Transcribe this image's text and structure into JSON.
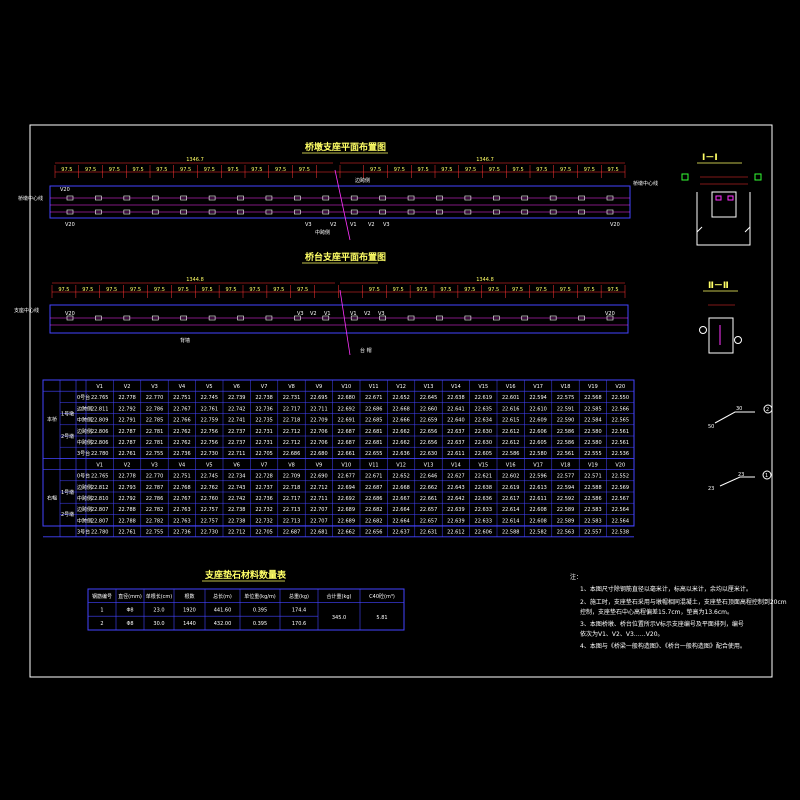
{
  "drawing": {
    "plan1_title": "桥墩支座平面布置图",
    "plan2_title": "桥台支座平面布置图",
    "material_title": "支座垫石材料数量表",
    "section1_title": "Ⅰ－Ⅰ",
    "section2_title": "Ⅱ－Ⅱ"
  },
  "plan1": {
    "dim_left": "1346.7",
    "dim_right": "1346.7",
    "spacing": "97.5",
    "label_left_end": "V20",
    "label_right_end": "V20",
    "label_left_mid": "V20",
    "label_center": "V1",
    "axis_left": "桥墩中心线",
    "axis_right": "桥墩中心线",
    "sub_labels": [
      "V3",
      "V2",
      "V1",
      "V1",
      "V2",
      "V3"
    ],
    "text_a": "边跨侧",
    "text_b": "中跨侧"
  },
  "plan2": {
    "dim_left": "1344.8",
    "dim_right": "1344.8",
    "spacing": "97.5",
    "label_left": "V20",
    "label_right": "V20",
    "axis_left": "支座中心线",
    "sub_labels": [
      "V3",
      "V2",
      "V1",
      "V1",
      "V2",
      "V3"
    ],
    "text_a": "背墙",
    "text_b": "台 帽"
  },
  "elev_table": {
    "cols": [
      "V1",
      "V2",
      "V3",
      "V4",
      "V5",
      "V6",
      "V7",
      "V8",
      "V9",
      "V10",
      "V11",
      "V12",
      "V13",
      "V14",
      "V15",
      "V16",
      "V17",
      "V18",
      "V19",
      "V20"
    ],
    "groups": [
      {
        "name": "本桥",
        "rows": [
          {
            "sub": "",
            "lab": "0号台",
            "vals": [
              "22.765",
              "22.778",
              "22.770",
              "22.751",
              "22.745",
              "22.739",
              "22.738",
              "22.731",
              "22.695",
              "22.680",
              "22.671",
              "22.652",
              "22.645",
              "22.638",
              "22.619",
              "22.601",
              "22.594",
              "22.575",
              "22.568",
              "22.550"
            ]
          },
          {
            "sub": "1号墩",
            "lab": "边跨侧",
            "vals": [
              "22.811",
              "22.792",
              "22.786",
              "22.767",
              "22.761",
              "22.742",
              "22.736",
              "22.717",
              "22.711",
              "22.692",
              "22.686",
              "22.668",
              "22.660",
              "22.641",
              "22.635",
              "22.616",
              "22.610",
              "22.591",
              "22.585",
              "22.566"
            ]
          },
          {
            "sub": "",
            "lab": "中跨侧",
            "vals": [
              "22.809",
              "22.791",
              "22.785",
              "22.766",
              "22.759",
              "22.741",
              "22.735",
              "22.718",
              "22.709",
              "22.691",
              "22.685",
              "22.666",
              "22.659",
              "22.640",
              "22.634",
              "22.615",
              "22.609",
              "22.590",
              "22.584",
              "22.565"
            ]
          },
          {
            "sub": "2号墩",
            "lab": "边跨侧",
            "vals": [
              "22.806",
              "22.787",
              "22.781",
              "22.762",
              "22.756",
              "22.737",
              "22.731",
              "22.712",
              "22.706",
              "22.687",
              "22.681",
              "22.662",
              "22.656",
              "22.637",
              "22.630",
              "22.612",
              "22.606",
              "22.586",
              "22.580",
              "22.561"
            ]
          },
          {
            "sub": "",
            "lab": "中跨侧",
            "vals": [
              "22.806",
              "22.787",
              "22.781",
              "22.762",
              "22.756",
              "22.737",
              "22.731",
              "22.712",
              "22.706",
              "22.687",
              "22.681",
              "22.662",
              "22.656",
              "22.637",
              "22.630",
              "22.612",
              "22.605",
              "22.586",
              "22.580",
              "22.561"
            ]
          },
          {
            "sub": "",
            "lab": "3号台",
            "vals": [
              "22.780",
              "22.761",
              "22.755",
              "22.736",
              "22.730",
              "22.711",
              "22.705",
              "22.686",
              "22.680",
              "22.661",
              "22.655",
              "22.636",
              "22.630",
              "22.611",
              "22.605",
              "22.586",
              "22.580",
              "22.561",
              "22.555",
              "22.536"
            ]
          }
        ]
      },
      {
        "name": "右幅",
        "rows": [
          {
            "sub": "",
            "lab": "0号台",
            "vals": [
              "22.765",
              "22.778",
              "22.770",
              "22.751",
              "22.745",
              "22.734",
              "22.728",
              "22.709",
              "22.690",
              "22.677",
              "22.671",
              "22.652",
              "22.646",
              "22.627",
              "22.621",
              "22.602",
              "22.596",
              "22.577",
              "22.571",
              "22.552"
            ]
          },
          {
            "sub": "1号墩",
            "lab": "边跨侧",
            "vals": [
              "22.812",
              "22.793",
              "22.787",
              "22.768",
              "22.762",
              "22.743",
              "22.737",
              "22.718",
              "22.712",
              "22.694",
              "22.687",
              "22.668",
              "22.662",
              "22.643",
              "22.638",
              "22.619",
              "22.613",
              "22.594",
              "22.588",
              "22.569"
            ]
          },
          {
            "sub": "",
            "lab": "中跨侧",
            "vals": [
              "22.810",
              "22.792",
              "22.786",
              "22.767",
              "22.760",
              "22.742",
              "22.736",
              "22.717",
              "22.711",
              "22.692",
              "22.686",
              "22.667",
              "22.661",
              "22.642",
              "22.636",
              "22.617",
              "22.611",
              "22.592",
              "22.586",
              "22.567"
            ]
          },
          {
            "sub": "2号墩",
            "lab": "边跨侧",
            "vals": [
              "22.807",
              "22.788",
              "22.782",
              "22.763",
              "22.757",
              "22.738",
              "22.732",
              "22.713",
              "22.707",
              "22.689",
              "22.682",
              "22.664",
              "22.657",
              "22.639",
              "22.633",
              "22.614",
              "22.608",
              "22.589",
              "22.583",
              "22.564"
            ]
          },
          {
            "sub": "",
            "lab": "中跨侧",
            "vals": [
              "22.807",
              "22.788",
              "22.782",
              "22.763",
              "22.757",
              "22.738",
              "22.732",
              "22.713",
              "22.707",
              "22.689",
              "22.682",
              "22.664",
              "22.657",
              "22.639",
              "22.633",
              "22.614",
              "22.608",
              "22.589",
              "22.583",
              "22.564"
            ]
          },
          {
            "sub": "",
            "lab": "3号台",
            "vals": [
              "22.780",
              "22.761",
              "22.755",
              "22.736",
              "22.730",
              "22.712",
              "22.705",
              "22.687",
              "22.681",
              "22.662",
              "22.656",
              "22.637",
              "22.631",
              "22.612",
              "22.606",
              "22.588",
              "22.582",
              "22.563",
              "22.557",
              "22.538"
            ]
          }
        ]
      }
    ]
  },
  "material_table": {
    "headers": [
      "钢筋编号",
      "直径(mm)",
      "单根长(cm)",
      "根数",
      "总长(m)",
      "单位重(kg/m)",
      "总重(kg)",
      "合计重(kg)",
      "C40砼(m³)"
    ],
    "rows": [
      [
        "1",
        "Φ8",
        "23.0",
        "1920",
        "441.60",
        "0.395",
        "174.4"
      ],
      [
        "2",
        "Φ8",
        "30.0",
        "1440",
        "432.00",
        "0.395",
        "170.6"
      ]
    ],
    "total": "345.0",
    "concrete": "5.81"
  },
  "rebar_details": [
    {
      "num": "2",
      "dim_a": "50",
      "dim_b": "30"
    },
    {
      "num": "1",
      "dim_a": "23",
      "dim_b": "23"
    }
  ],
  "notes": {
    "title": "注：",
    "lines": [
      "1、本图尺寸除钢筋直径以毫米计，标高以米计，余均以厘米计。",
      "2、施工时，支座垫石采用与墩帽相同混凝土，支座垫石顶面高程控制到20cm",
      "   控制，支座垫石中心高程偏差15.7cm，垫高为13.6cm。",
      "3、本图桥墩、桥台位置所示V标示支座编号及平面排列，编号",
      "   依次为V1、V2、V3……V20。",
      "4、本图与《桥梁一般构造图》、《桥台一般构造图》配合使用。"
    ]
  },
  "colors": {
    "background": "#000000",
    "line": "#ffffff",
    "accent": "#ffff66",
    "blue": "#4444ff",
    "magenta": "#ff33ff",
    "green": "#33ff33",
    "red": "#ff3333"
  }
}
